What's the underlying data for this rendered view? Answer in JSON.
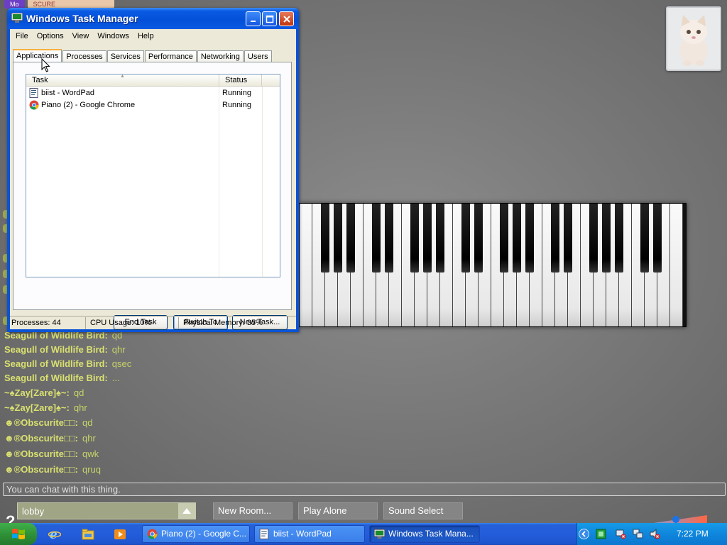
{
  "page_tabs": [
    "Mo",
    "SCURE"
  ],
  "chat": {
    "lines": [
      {
        "name": "Seagull of Wildlife Bird:",
        "msg": "qd"
      },
      {
        "name": "Seagull of Wildlife Bird:",
        "msg": "qhr"
      },
      {
        "name": "Seagull of Wildlife Bird:",
        "msg": "qsec"
      },
      {
        "name": "Seagull of Wildlife Bird:",
        "msg": "..."
      },
      {
        "name": "~♠Zay[Zare]♠~:",
        "msg": "qd"
      },
      {
        "name": "~♠Zay[Zare]♠~:",
        "msg": "qhr"
      },
      {
        "name": "☻®Obscurite□□:",
        "msg": "qd"
      },
      {
        "name": "☻®Obscurite□□:",
        "msg": "qhr"
      },
      {
        "name": "☻®Obscurite□□:",
        "msg": "qwk"
      },
      {
        "name": "☻®Obscurite□□:",
        "msg": "qruq"
      }
    ],
    "input_placeholder": "You can chat with this thing."
  },
  "controls": {
    "room_value": "lobby",
    "new_room": "New Room...",
    "play_alone": "Play Alone",
    "sound_select": "Sound Select",
    "help_glyph": "?"
  },
  "task_manager": {
    "title": "Windows Task Manager",
    "menu": [
      "File",
      "Options",
      "View",
      "Windows",
      "Help"
    ],
    "tabs": [
      "Applications",
      "Processes",
      "Services",
      "Performance",
      "Networking",
      "Users"
    ],
    "active_tab": "Applications",
    "columns": {
      "task": "Task",
      "status": "Status"
    },
    "rows": [
      {
        "task": "biist - WordPad",
        "status": "Running",
        "icon": "wordpad-icon"
      },
      {
        "task": "Piano (2) - Google Chrome",
        "status": "Running",
        "icon": "chrome-icon"
      }
    ],
    "buttons": {
      "end_task": "End Task",
      "switch_to": "Switch To",
      "new_task": "New Task..."
    },
    "status": {
      "processes": "Processes: 44",
      "cpu": "CPU Usage: 10%",
      "memory": "Physical Memory: 35%"
    }
  },
  "taskbar": {
    "items": [
      {
        "label": "Piano (2) - Google C...",
        "icon": "chrome-icon",
        "active": false
      },
      {
        "label": "biist - WordPad",
        "icon": "wordpad-icon",
        "active": false
      },
      {
        "label": "Windows Task Mana...",
        "icon": "taskmgr-icon",
        "active": true
      }
    ],
    "clock": "7:22 PM"
  },
  "colors": {
    "chat_name": "#d9e070",
    "xp_blue": "#0a53d6",
    "taskbar_blue": "#245ddb"
  }
}
